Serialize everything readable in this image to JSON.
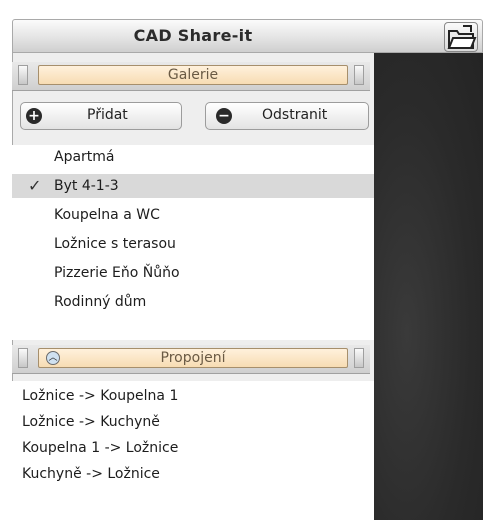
{
  "app": {
    "title": "CAD Share-it"
  },
  "galerie": {
    "header": "Galerie",
    "add_label": "Přidat",
    "remove_label": "Odstranit",
    "items": [
      {
        "label": "Apartmá",
        "selected": false
      },
      {
        "label": "Byt 4-1-3",
        "selected": true
      },
      {
        "label": "Koupelna a WC",
        "selected": false
      },
      {
        "label": "Ložnice s terasou",
        "selected": false
      },
      {
        "label": "Pizzerie Eňo Ňůňo",
        "selected": false
      },
      {
        "label": "Rodinný dům",
        "selected": false
      }
    ],
    "check_glyph": "✓"
  },
  "propojeni": {
    "header": "Propojení",
    "items": [
      "Ložnice -> Koupelna 1",
      "Ložnice -> Kuchyně",
      "Koupelna 1  -> Ložnice",
      "Kuchyně -> Ložnice"
    ]
  },
  "colors": {
    "section_bar": "#f7dcb3",
    "selected_row": "#d9d9d9",
    "viewport": "#2a2a2a"
  },
  "icons": {
    "add": "plus-circle-icon",
    "remove": "minus-circle-icon",
    "open": "folder-open-icon",
    "collapse": "chevron-up-circle-icon"
  }
}
